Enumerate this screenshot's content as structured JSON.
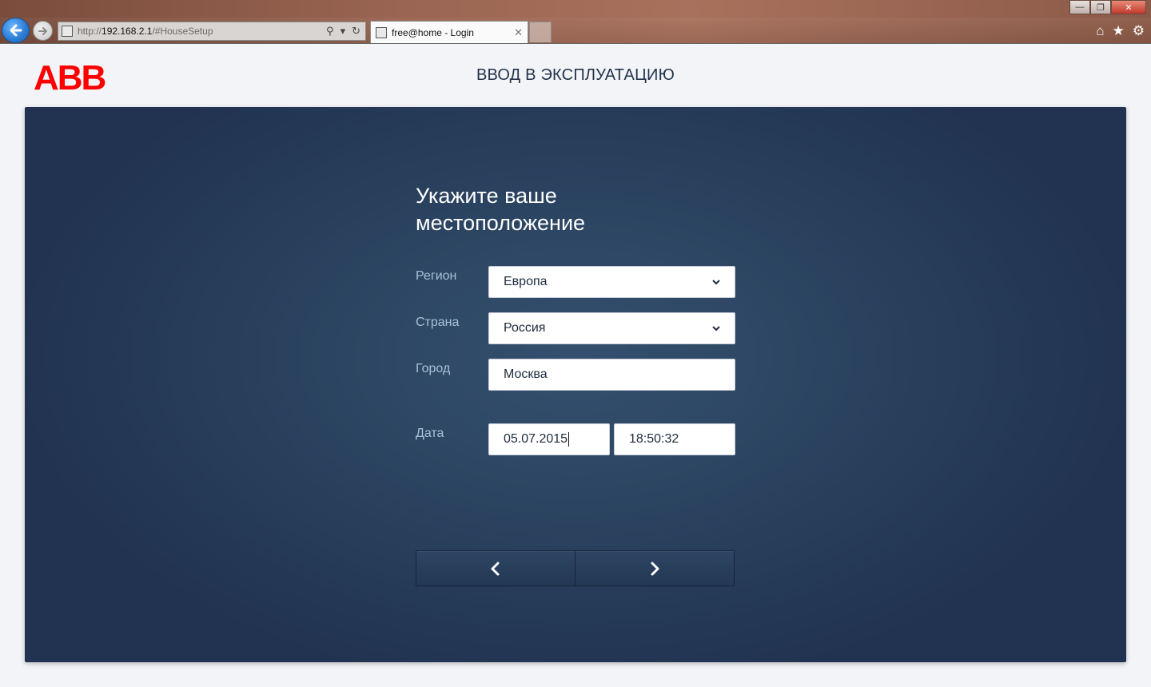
{
  "browser": {
    "url_prefix": "http://",
    "url_host": "192.168.2.1",
    "url_path": "/#HouseSetup",
    "tab_title": "free@home - Login"
  },
  "header": {
    "logo": "ABB",
    "title": "ВВОД В ЭКСПЛУАТАЦИЮ"
  },
  "form": {
    "heading_line1": "Укажите ваше",
    "heading_line2": "местоположение",
    "region_label": "Регион",
    "region_value": "Европа",
    "country_label": "Страна",
    "country_value": "Россия",
    "city_label": "Город",
    "city_value": "Москва",
    "date_label": "Дата",
    "date_value": "05.07.2015",
    "time_value": "18:50:32"
  },
  "colors": {
    "brand": "#ff0000",
    "panel": "#2b4461",
    "label": "#a9c0db"
  },
  "icons": {
    "back": "arrow-left-icon",
    "forward": "arrow-right-icon",
    "prev": "chevron-left-icon",
    "next": "chevron-right-icon"
  }
}
